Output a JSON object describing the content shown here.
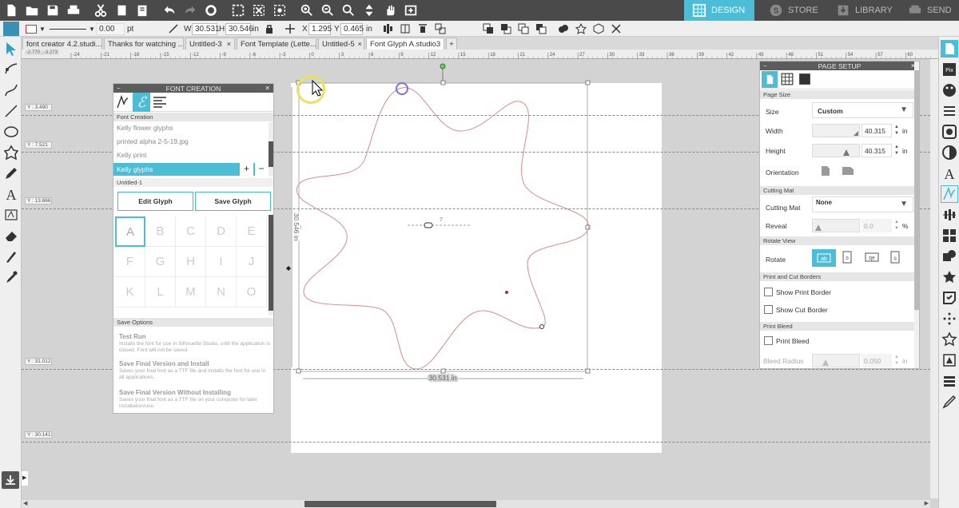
{
  "nav": {
    "design": "DESIGN",
    "store": "STORE",
    "library": "LIBRARY",
    "send": "SEND",
    "accent": "#4bbdd6"
  },
  "propbar": {
    "line_width": "0.00",
    "line_unit": "pt",
    "w_label": "W",
    "w_value": "30.531",
    "h_label": "H",
    "h_value": "30.546",
    "size_unit": "in",
    "x_label": "X",
    "x_value": "1.295",
    "y_label": "Y",
    "y_value": "0.465",
    "pos_unit": "in"
  },
  "tabs": [
    {
      "label": "font creator 4.2.studi...",
      "close": "×"
    },
    {
      "label": "Thanks for watching ...",
      "close": "×"
    },
    {
      "label": "Untitled-3",
      "close": "×"
    },
    {
      "label": "Font Template (Lette...",
      "close": "×"
    },
    {
      "label": "Untitled-5",
      "close": "×"
    },
    {
      "label": "Font Glyph A.studio3",
      "close": "×"
    },
    {
      "label": "+",
      "close": ""
    }
  ],
  "ruler": {
    "ticks": [
      "-24",
      "-21",
      "-18",
      "-15",
      "-12",
      "-9",
      "-6",
      "-3",
      "0",
      "3",
      "6",
      "9",
      "12",
      "15",
      "18",
      "21",
      "24",
      "27",
      "30",
      "33",
      "36",
      "39",
      "42",
      "45",
      "48",
      "51",
      "54",
      "57",
      "60"
    ],
    "readout": "-2.770 , -3.273"
  },
  "guides": [
    {
      "label": "Y : 3.490"
    },
    {
      "label": "Y : 7.521"
    },
    {
      "label": "Y : 13.666"
    },
    {
      "label": "Y : 31.012"
    },
    {
      "label": "Y : 30.141"
    }
  ],
  "canvas": {
    "dim_h": "30.531 in",
    "dim_v": "30.546 in",
    "center_mark": "7"
  },
  "font_panel": {
    "title": "FONT CREATION",
    "section_label": "Font Creation",
    "list": [
      "Kelly flower glyphs",
      "printed alpha 2-5-19.jpg",
      "Kelly print",
      "Kelly glyphs"
    ],
    "list_add": "+",
    "list_remove": "−",
    "doc_label": "Untitled-1",
    "edit_glyph": "Edit Glyph",
    "save_glyph": "Save Glyph",
    "glyphs": [
      "A",
      "B",
      "C",
      "D",
      "E",
      "F",
      "G",
      "H",
      "I",
      "J",
      "K",
      "L",
      "M",
      "N",
      "O"
    ],
    "save_options_label": "Save Options",
    "options": [
      {
        "title": "Test Run",
        "desc": "Installs the font for use in Silhouette Studio, until the application is closed. Font will not be saved."
      },
      {
        "title": "Save Final Version and Install",
        "desc": "Saves your final font as a TTF file and installs the font for use in all applications."
      },
      {
        "title": "Save Final Version Without Installing",
        "desc": "Saves your final font as a TTF file on your computer for later installation/use."
      }
    ]
  },
  "page_setup": {
    "title": "PAGE SETUP",
    "page_size_section": "Page Size",
    "size_label": "Size",
    "size_value": "Custom",
    "width_label": "Width",
    "width_value": "40.315",
    "width_unit": "in",
    "height_label": "Height",
    "height_value": "40.315",
    "height_unit": "in",
    "orientation_label": "Orientation",
    "cutting_mat_section": "Cutting Mat",
    "cutting_mat_label": "Cutting Mat",
    "cutting_mat_value": "None",
    "reveal_label": "Reveal",
    "reveal_value": "0.0",
    "reveal_unit": "%",
    "rotate_view_section": "Rotate View",
    "rotate_label": "Rotate",
    "print_cut_section": "Print and Cut Borders",
    "show_print_border": "Show Print Border",
    "show_cut_border": "Show Cut Border",
    "print_bleed_section": "Print Bleed",
    "print_bleed": "Print Bleed",
    "bleed_radius_label": "Bleed Radius",
    "bleed_radius_value": "0.050",
    "bleed_radius_unit": "in"
  }
}
